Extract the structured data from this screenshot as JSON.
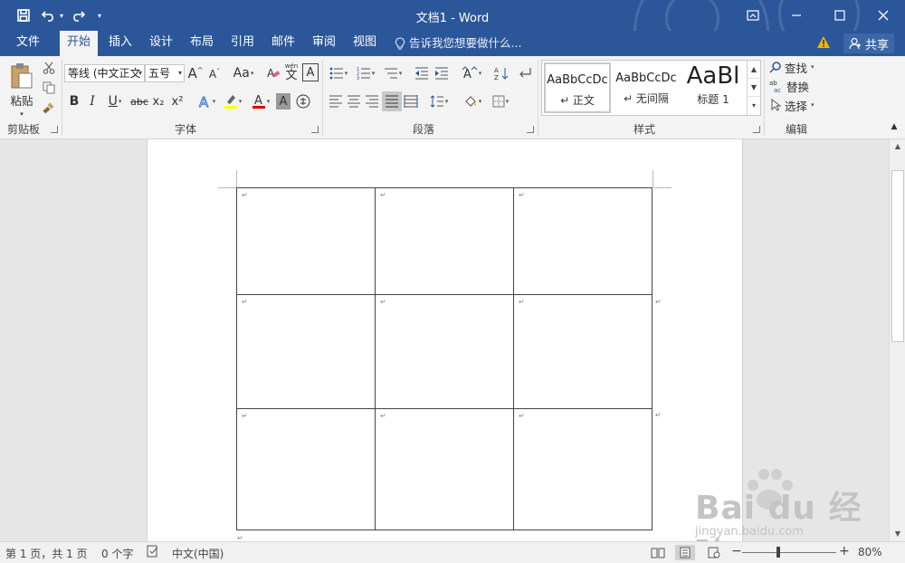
{
  "titlebar": {
    "title": "文档1 - Word",
    "qat": {
      "save_icon": "save-icon",
      "undo_icon": "undo-icon",
      "redo_icon": "redo-icon",
      "customize": "▾"
    },
    "controls": {
      "restore_ribbon": "ribbon-display-icon",
      "minimize": "minimize-icon",
      "maximize": "maximize-icon",
      "close": "close-icon"
    }
  },
  "tabs": {
    "items": [
      "文件",
      "开始",
      "插入",
      "设计",
      "布局",
      "引用",
      "邮件",
      "审阅",
      "视图"
    ],
    "active": "开始",
    "tellme": "告诉我您想要做什么...",
    "share": "共享"
  },
  "ribbon": {
    "clipboard": {
      "paste": "粘贴",
      "label": "剪贴板"
    },
    "font": {
      "font_name": "等线 (中文正文",
      "font_size": "五号",
      "label": "字体",
      "bold": "B",
      "italic": "I",
      "underline": "U",
      "strike": "abc",
      "subscript": "x₂",
      "superscript": "x²",
      "change_case": "Aa",
      "grow": "A",
      "shrink": "A",
      "wen": "wén",
      "wen_char": "文",
      "border_char": "A"
    },
    "paragraph": {
      "label": "段落"
    },
    "styles": {
      "label": "样式",
      "items": [
        {
          "sample": "AaBbCcDc",
          "name": "↵ 正文"
        },
        {
          "sample": "AaBbCcDc",
          "name": "↵ 无间隔"
        },
        {
          "sample": "AaBl",
          "name": "标题 1"
        }
      ]
    },
    "editing": {
      "find": "查找",
      "replace": "替换",
      "select": "选择",
      "label": "编辑"
    }
  },
  "document": {
    "rows": 3,
    "cols": 3,
    "cell_mark": "↵",
    "end_mark": "↵"
  },
  "watermark": {
    "main": "Bai du 经验",
    "sub": "jingyan.baidu.com"
  },
  "status": {
    "page": "第 1 页，共 1 页",
    "words": "0 个字",
    "language": "中文(中国)",
    "zoom": "80%",
    "zoom_minus": "−",
    "zoom_plus": "+"
  },
  "colors": {
    "accent": "#2b579a",
    "highlight": "#ffff00",
    "font_color": "#e00000"
  }
}
